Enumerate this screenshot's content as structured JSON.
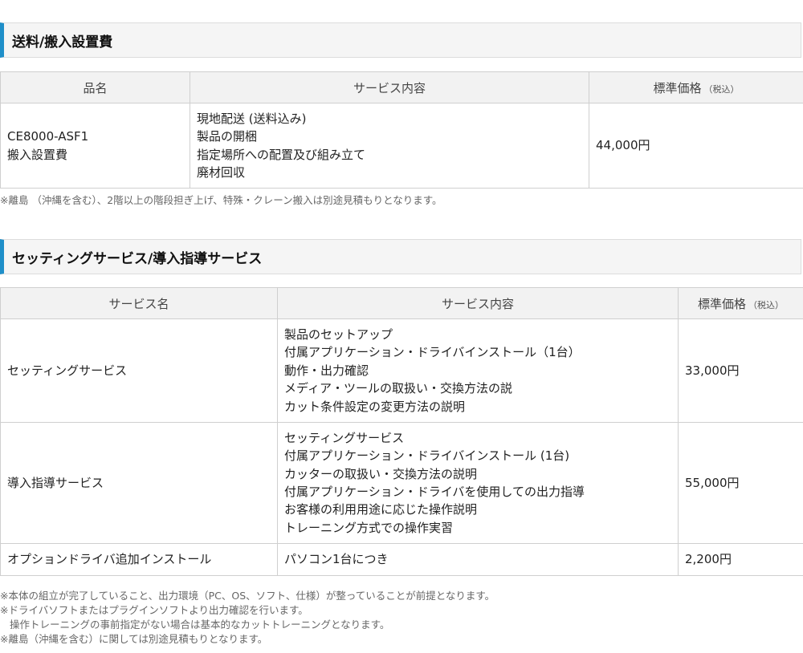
{
  "section1": {
    "title": "送料/搬入設置費",
    "headers": [
      "品名",
      "サービス内容",
      "標準価格",
      "（税込）"
    ],
    "row": {
      "item": [
        "CE8000-ASF1",
        "搬入設置費"
      ],
      "content": [
        "現地配送 (送料込み)",
        "製品の開梱",
        "指定場所への配置及び組み立て",
        "廃材回収"
      ],
      "price": "44,000円"
    },
    "note": "※離島 （沖縄を含む）、2階以上の階段担ぎ上げ、特殊・クレーン搬入は別途見積もりとなります。"
  },
  "section2": {
    "title": "セッティングサービス/導入指導サービス",
    "headers": [
      "サービス名",
      "サービス内容",
      "標準価格",
      "（税込）"
    ],
    "rows": [
      {
        "name": "セッティングサービス",
        "content": [
          "製品のセットアップ",
          "付属アプリケーション・ドライバインストール（1台）",
          "動作・出力確認",
          "メディア・ツールの取扱い・交換方法の説",
          "カット条件設定の変更方法の説明"
        ],
        "price": "33,000円"
      },
      {
        "name": "導入指導サービス",
        "content": [
          "セッティングサービス",
          "付属アプリケーション・ドライバインストール (1台)",
          "カッターの取扱い・交換方法の説明",
          "付属アプリケーション・ドライバを使用しての出力指導",
          "お客様の利用用途に応じた操作説明",
          "トレーニング方式での操作実習"
        ],
        "price": "55,000円"
      },
      {
        "name": "オプションドライバ追加インストール",
        "content": [
          "パソコン1台につき"
        ],
        "price": "2,200円"
      }
    ],
    "notes": [
      "※本体の組立が完了していること、出力環境（PC、OS、ソフト、仕様）が整っていることが前提となります。",
      "※ドライバソフトまたはプラグインソフトより出力確認を行います。",
      "操作トレーニングの事前指定がない場合は基本的なカットトレーニングとなります。",
      "※離島（沖縄を含む）に関しては別途見積もりとなります。"
    ]
  }
}
